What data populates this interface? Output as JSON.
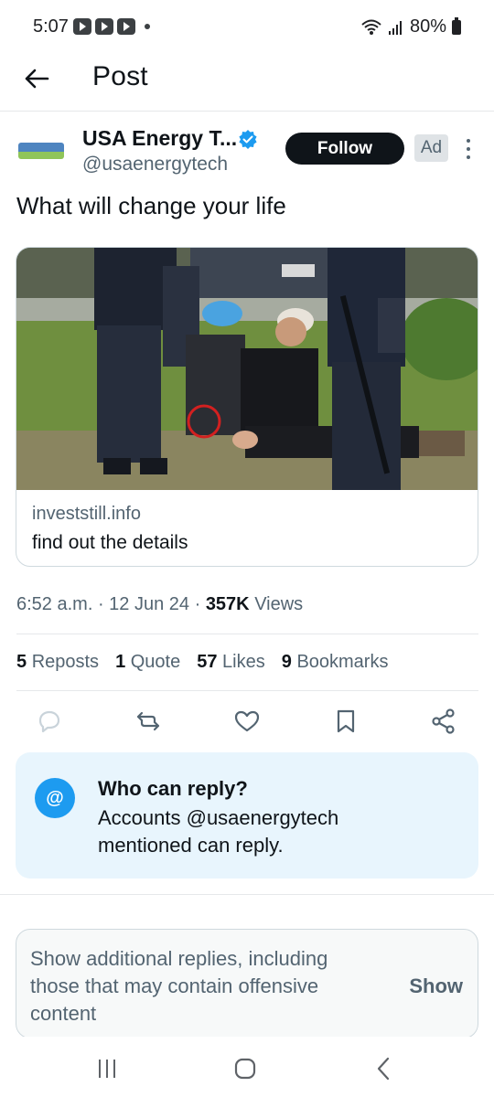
{
  "status_bar": {
    "time": "5:07",
    "battery": "80%"
  },
  "header": {
    "title": "Post"
  },
  "author": {
    "display_name": "USA Energy T...",
    "handle": "@usaenergytech",
    "follow_label": "Follow",
    "ad_label": "Ad",
    "verified": true
  },
  "post": {
    "text": "What will change your life",
    "card": {
      "domain": "investstill.info",
      "title": "find out the details"
    },
    "time": "6:52 a.m.",
    "date": "12 Jun 24",
    "views_count": "357K",
    "views_label": "Views"
  },
  "stats": {
    "reposts_count": "5",
    "reposts_label": "Reposts",
    "quotes_count": "1",
    "quotes_label": "Quote",
    "likes_count": "57",
    "likes_label": "Likes",
    "bookmarks_count": "9",
    "bookmarks_label": "Bookmarks"
  },
  "actions": [
    "reply-icon",
    "repost-icon",
    "like-icon",
    "bookmark-icon",
    "share-icon"
  ],
  "reply_settings": {
    "icon": "@",
    "title": "Who can reply?",
    "description": "Accounts @usaenergytech mentioned can reply."
  },
  "additional_replies": {
    "text": "Show additional replies, including those that may contain offensive content",
    "button": "Show"
  },
  "colors": {
    "accent": "#1d9bf0",
    "text": "#0f1419",
    "secondary": "#536471",
    "reply_box_bg": "#e8f5fd"
  }
}
